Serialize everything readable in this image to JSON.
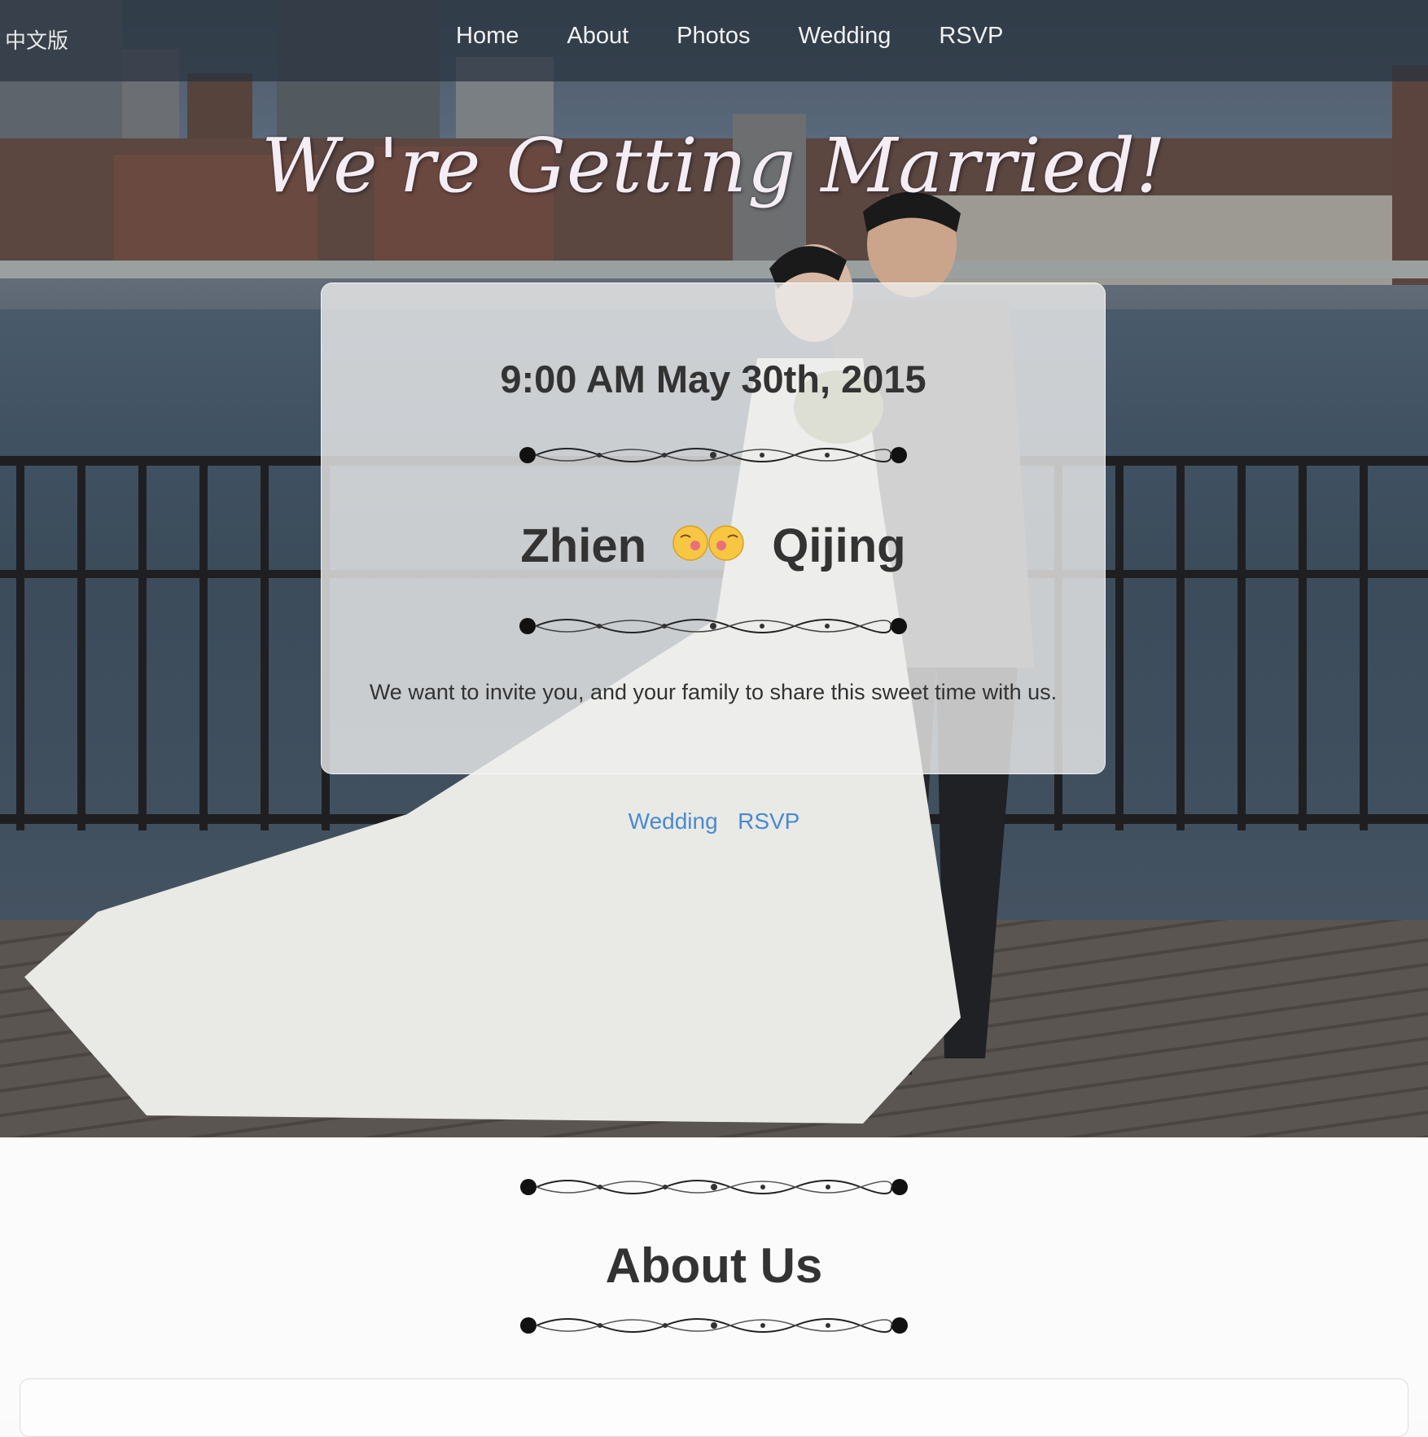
{
  "nav": {
    "language_link": "中文版",
    "links": [
      "Home",
      "About",
      "Photos",
      "Wedding",
      "RSVP"
    ]
  },
  "hero": {
    "title": "We're Getting Married!",
    "date": "9:00 AM May 30th, 2015",
    "groom": "Zhien",
    "bride": "Qijing",
    "invite": "We want to invite you, and your family to share this sweet time with us.",
    "links": [
      "Wedding",
      "RSVP"
    ]
  },
  "about": {
    "title": "About Us"
  },
  "colors": {
    "link": "#4a8ad0",
    "text": "#333333",
    "nav_bg": "#28323e"
  },
  "icons": [
    "ornament-divider-icon",
    "kissing-faces-icon"
  ]
}
